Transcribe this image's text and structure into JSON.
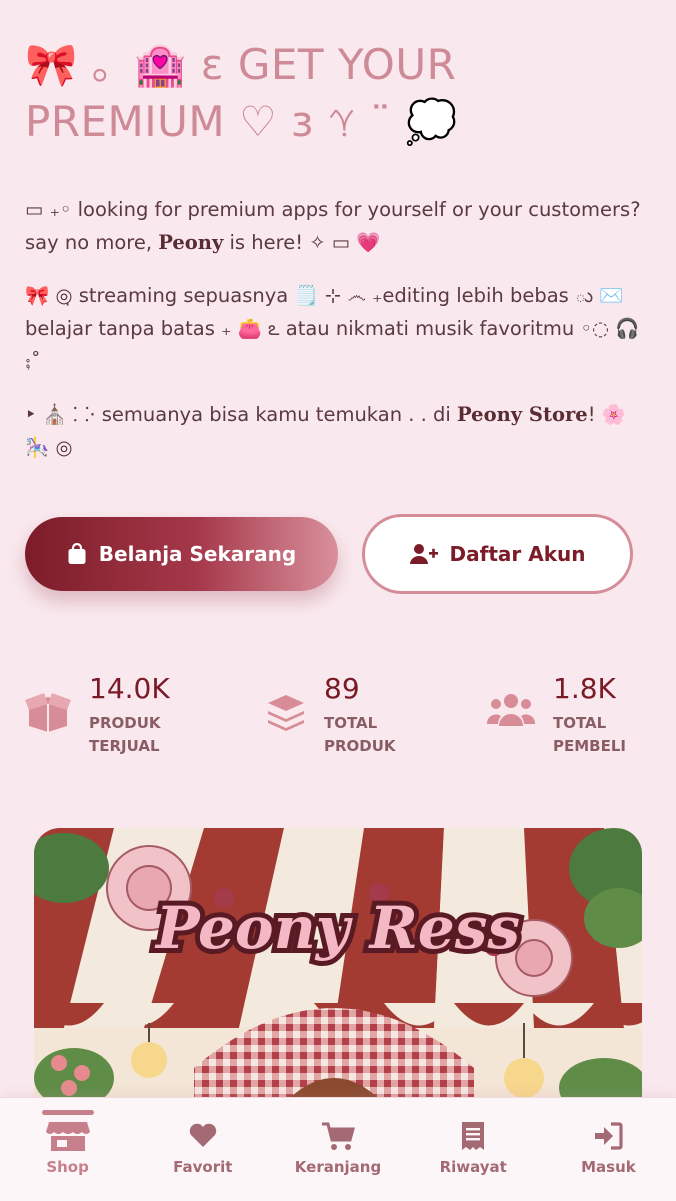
{
  "hero": {
    "line1": "🎀 。🏩 ε GET YOUR",
    "line2": "PREMIUM ♡ з 𖨯 ¨ 💭"
  },
  "intro": {
    "part1": "▭ ₊◦ looking for premium apps for yourself or your customers? say no more, ",
    "brand": "Peony",
    "part2": " is here! ✧ ▭ 💗"
  },
  "features": "🎀 ◎̣ streaming sepuasnya 🗒️ ⊹ ෴ ₊editing lebih bebas ు ✉️ belajar tanpa batas ₊ 👛 ఽ atau nikmati musik favoritmu ◦◌ 🎧 ⨟˚",
  "closing": {
    "part1": "‣ ⛪ ⸬· semuanya bisa kamu temukan . . di ",
    "brand": "Peony Store",
    "part2": "! 🌸 🎠 ◎"
  },
  "buttons": {
    "shop": "Belanja Sekarang",
    "register": "Daftar Akun"
  },
  "stats": [
    {
      "value": "14.0K",
      "label1": "PRODUK",
      "label2": "TERJUAL",
      "icon": "box-open-icon"
    },
    {
      "value": "89",
      "label1": "TOTAL",
      "label2": "PRODUK",
      "icon": "layers-icon"
    },
    {
      "value": "1.8K",
      "label1": "TOTAL",
      "label2": "PEMBELI",
      "icon": "users-icon"
    }
  ],
  "banner": {
    "logo_text": "Peony Ress"
  },
  "nav": [
    {
      "label": "Shop",
      "icon": "store-icon",
      "active": true
    },
    {
      "label": "Favorit",
      "icon": "heart-icon",
      "active": false
    },
    {
      "label": "Keranjang",
      "icon": "cart-icon",
      "active": false
    },
    {
      "label": "Riwayat",
      "icon": "receipt-icon",
      "active": false
    },
    {
      "label": "Masuk",
      "icon": "login-icon",
      "active": false
    }
  ],
  "colors": {
    "background": "#f9e9ee",
    "accent": "#7c1c28",
    "pink": "#cf8a97"
  }
}
